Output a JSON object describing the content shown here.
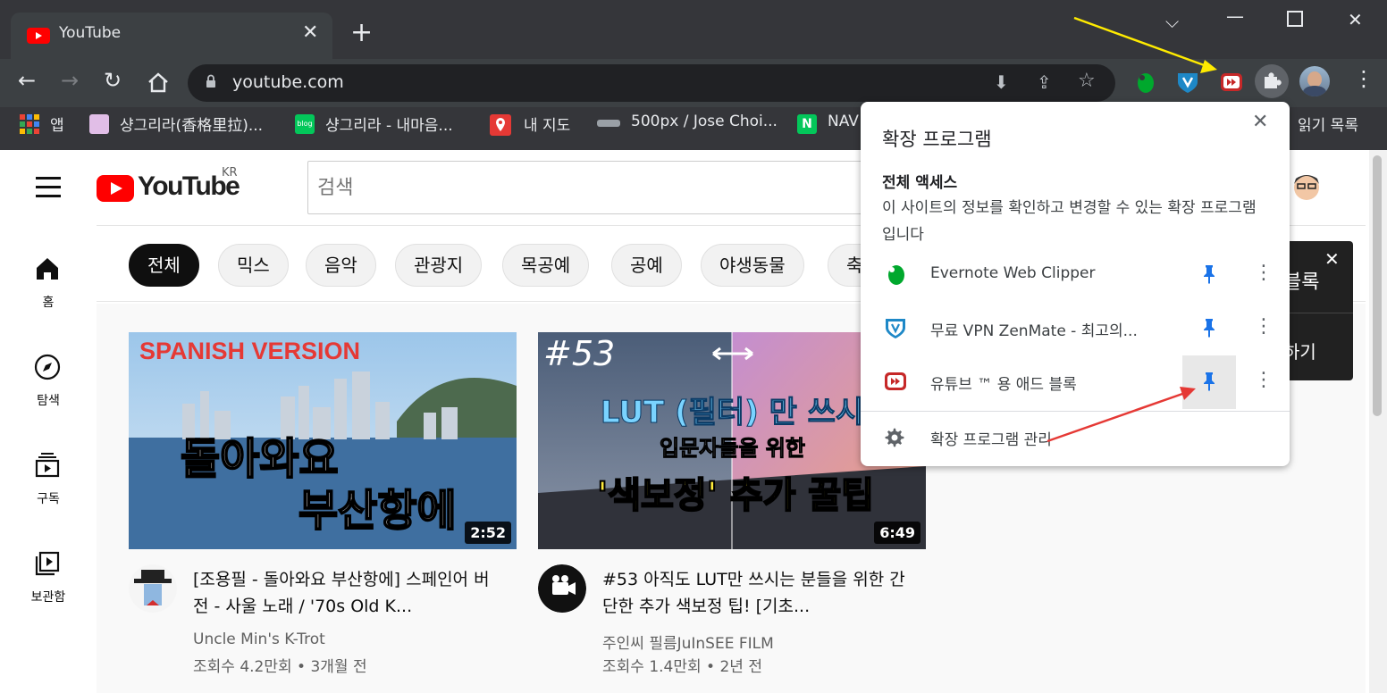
{
  "browser": {
    "tab_title": "YouTube",
    "url": "youtube.com",
    "bookmarks": [
      {
        "label": "앱"
      },
      {
        "label": "샹그리라(香格里拉)..."
      },
      {
        "label": "샹그리라 - 내마음..."
      },
      {
        "label": "내 지도"
      },
      {
        "label": "500px / Jose Choi..."
      },
      {
        "label": "NAV"
      },
      {
        "label": "읽기 목록"
      }
    ]
  },
  "youtube": {
    "logo_text": "YouTube",
    "region": "KR",
    "search_placeholder": "검색",
    "guide": [
      {
        "label": "홈"
      },
      {
        "label": "탐색"
      },
      {
        "label": "구독"
      },
      {
        "label": "보관함"
      }
    ],
    "chips": [
      "전체",
      "믹스",
      "음악",
      "관광지",
      "목공예",
      "공예",
      "야생동물",
      "축"
    ],
    "videos": [
      {
        "title": "[조용필 - 돌아와요 부산항에] 스페인어 버전 - 사울 노래 / '70s Old K...",
        "channel": "Uncle Min's K-Trot",
        "meta": "조회수 4.2만회 • 3개월 전",
        "duration": "2:52",
        "thumb_top": "SPANISH VERSION",
        "thumb_line1": "돌아와요",
        "thumb_line2": "부산항에"
      },
      {
        "title": "#53 아직도 LUT만 쓰시는 분들을 위한 간단한 추가 색보정 팁! [기초...",
        "channel": "주인씨 필름JuInSEE FILM",
        "meta": "조회수 1.4만회 • 2년 전",
        "duration": "6:49",
        "thumb_num": "#53",
        "thumb_line1": "LUT (필터) 만 쓰시는",
        "thumb_line2": "입문자들을 위한",
        "thumb_line3": "'색보정' 추가 꿀팁"
      }
    ],
    "toast": {
      "line1": "블록",
      "line2": "하기"
    }
  },
  "extensions_popup": {
    "title": "확장 프로그램",
    "section_title": "전체 액세스",
    "section_desc": "이 사이트의 정보를 확인하고 변경할 수 있는 확장 프로그램입니다",
    "items": [
      {
        "name": "Evernote Web Clipper",
        "icon": "evernote-icon",
        "color": "#00a82d"
      },
      {
        "name": "무료 VPN ZenMate - 최고의...",
        "icon": "zenmate-shield-icon",
        "color": "#1e88c7"
      },
      {
        "name": "유튜브 ™ 용 애드 블록",
        "icon": "adblock-youtube-icon",
        "color": "#c62828"
      }
    ],
    "manage_label": "확장 프로그램 관리"
  },
  "colors": {
    "pin_blue": "#1a73e8",
    "arrow_yellow": "#ffeb00",
    "arrow_red": "#e53935",
    "youtube_red": "#ff0000"
  }
}
